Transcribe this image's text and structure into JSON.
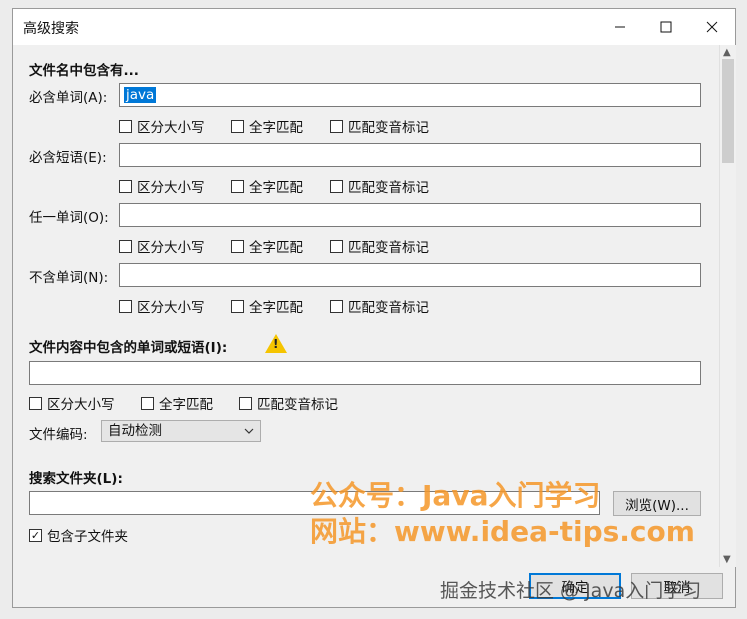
{
  "window": {
    "title": "高级搜索"
  },
  "section_filename": {
    "heading": "文件名中包含有...",
    "rows": [
      {
        "label": "必含单词(A):",
        "value": "java",
        "checks": [
          "区分大小写",
          "全字匹配",
          "匹配变音标记"
        ]
      },
      {
        "label": "必含短语(E):",
        "value": "",
        "checks": [
          "区分大小写",
          "全字匹配",
          "匹配变音标记"
        ]
      },
      {
        "label": "任一单词(O):",
        "value": "",
        "checks": [
          "区分大小写",
          "全字匹配",
          "匹配变音标记"
        ]
      },
      {
        "label": "不含单词(N):",
        "value": "",
        "checks": [
          "区分大小写",
          "全字匹配",
          "匹配变音标记"
        ]
      }
    ]
  },
  "section_content": {
    "heading": "文件内容中包含的单词或短语(I):",
    "value": "",
    "checks": [
      "区分大小写",
      "全字匹配",
      "匹配变音标记"
    ],
    "encoding_label": "文件编码:",
    "encoding_value": "自动检测"
  },
  "section_folder": {
    "heading": "搜索文件夹(L):",
    "value": "",
    "browse_label": "浏览(W)...",
    "subfolders_label": "包含子文件夹",
    "subfolders_checked": true
  },
  "footer": {
    "ok_label": "确定",
    "cancel_label": "取消"
  },
  "watermark": {
    "line1": "公众号：Java入门学习",
    "line2": "网站：www.idea-tips.com",
    "bottom": "掘金技术社区 @ Java入门学习"
  },
  "icons": {
    "warning": "warning-icon",
    "minimize": "minimize-icon",
    "maximize": "maximize-icon",
    "close": "close-icon"
  },
  "colors": {
    "selection": "#0078d7",
    "watermark": "#f59628",
    "warning": "#f5c400"
  }
}
